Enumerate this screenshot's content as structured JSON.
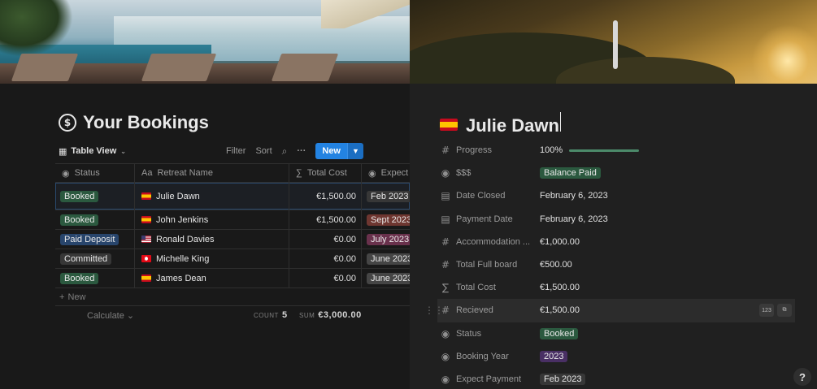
{
  "left": {
    "page_title": "Your Bookings",
    "page_icon": "$",
    "view_tab": "Table View",
    "toolbar": {
      "filter": "Filter",
      "sort": "Sort",
      "more": "···",
      "new": "New"
    },
    "columns": [
      {
        "label": "Status",
        "icon": "status-icon"
      },
      {
        "label": "Retreat Name",
        "icon": "text-icon",
        "prefix": "Aa"
      },
      {
        "label": "Total Cost",
        "icon": "sigma-icon",
        "prefix": "∑"
      },
      {
        "label": "Expect F",
        "icon": "status-icon"
      }
    ],
    "rows": [
      {
        "status": "Booked",
        "status_color": "#2b593f",
        "flag": "es",
        "name": "Julie Dawn",
        "cost": "€1,500.00",
        "expect": "Feb 2023",
        "expect_color": "#373737"
      },
      {
        "status": "Booked",
        "status_color": "#2b593f",
        "flag": "es",
        "name": "John Jenkins",
        "cost": "€1,500.00",
        "expect": "Sept 2023",
        "expect_color": "#6e3630"
      },
      {
        "status": "Paid Deposit",
        "status_color": "#28456c",
        "flag": "us",
        "name": "Ronald Davies",
        "cost": "€0.00",
        "expect": "July 2023",
        "expect_color": "#69314c"
      },
      {
        "status": "Committed",
        "status_color": "#373737",
        "flag": "tr",
        "name": "Michelle King",
        "cost": "€0.00",
        "expect": "June 2023",
        "expect_color": "#454545"
      },
      {
        "status": "Booked",
        "status_color": "#2b593f",
        "flag": "es",
        "name": "James Dean",
        "cost": "€0.00",
        "expect": "June 2023",
        "expect_color": "#454545"
      }
    ],
    "new_row": "New",
    "calculate": "Calculate",
    "count_label": "COUNT",
    "count_value": "5",
    "sum_label": "SUM",
    "sum_value": "€3,000.00"
  },
  "right": {
    "title": "Julie Dawn",
    "properties": [
      {
        "icon": "#",
        "label": "Progress",
        "value": "100%",
        "type": "progress",
        "progress": 1.0
      },
      {
        "icon": "◉",
        "label": "$$$",
        "value": "Balance Paid",
        "type": "tag",
        "color": "#2b593f"
      },
      {
        "icon": "▤",
        "label": "Date Closed",
        "value": "February 6, 2023",
        "type": "text"
      },
      {
        "icon": "▤",
        "label": "Payment Date",
        "value": "February 6, 2023",
        "type": "text"
      },
      {
        "icon": "#",
        "label": "Accommodation ...",
        "value": "€1,000.00",
        "type": "text"
      },
      {
        "icon": "#",
        "label": "Total Full board",
        "value": "€500.00",
        "type": "text"
      },
      {
        "icon": "∑",
        "label": "Total Cost",
        "value": "€1,500.00",
        "type": "text"
      },
      {
        "icon": "#",
        "label": "Recieved",
        "value": "€1,500.00",
        "type": "hover",
        "badge": "123"
      },
      {
        "icon": "◉",
        "label": "Status",
        "value": "Booked",
        "type": "tag",
        "color": "#2b593f"
      },
      {
        "icon": "◉",
        "label": "Booking Year",
        "value": "2023",
        "type": "tag",
        "color": "#492f64"
      },
      {
        "icon": "◉",
        "label": "Expect Payment",
        "value": "Feb 2023",
        "type": "tag",
        "color": "#373737"
      }
    ],
    "help": "?"
  }
}
